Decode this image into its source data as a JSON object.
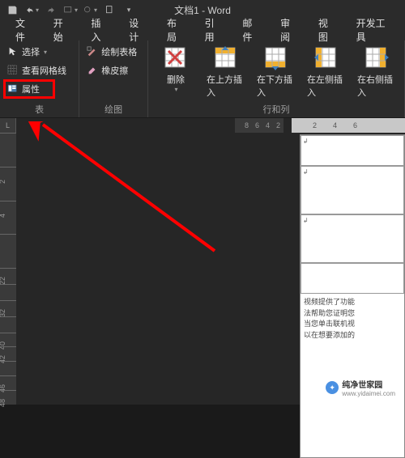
{
  "title": "文档1 - Word",
  "qat": {
    "save": "保存",
    "undo": "撤销",
    "redo": "重做"
  },
  "tabs": [
    "文件",
    "开始",
    "插入",
    "设计",
    "布局",
    "引用",
    "邮件",
    "审阅",
    "视图",
    "开发工具"
  ],
  "ribbon": {
    "table_group": {
      "label": "表",
      "select": "选择",
      "view_gridlines": "查看网格线",
      "properties": "属性"
    },
    "draw_group": {
      "label": "绘图",
      "draw_table": "绘制表格",
      "eraser": "橡皮擦"
    },
    "rows_cols_group": {
      "label": "行和列",
      "delete": "删除",
      "insert_above": "在上方插入",
      "insert_below": "在下方插入",
      "insert_left": "在左侧插入",
      "insert_right": "在右侧插入"
    }
  },
  "hruler_dark": [
    "8",
    "6",
    "4",
    "2"
  ],
  "hruler_light": [
    "2",
    "4",
    "6"
  ],
  "vruler": [
    "",
    "2",
    "4",
    "",
    "22",
    "",
    "32",
    "",
    "40",
    "42",
    "",
    "46",
    "48"
  ],
  "doc_body": {
    "para": "视频提供了功能\n法帮助您证明您\n当您单击联机视\n以在想要添加的"
  },
  "watermark": {
    "brand": "纯净世家园",
    "url": "www.yidaimei.com"
  }
}
